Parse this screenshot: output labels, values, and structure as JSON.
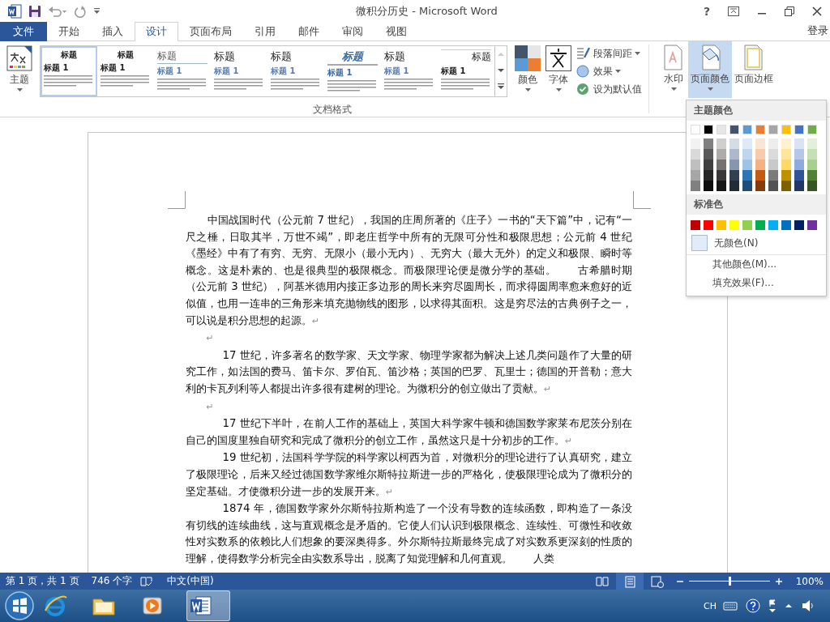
{
  "title_bar": {
    "title": "微积分历史 - Microsoft Word",
    "help": "?",
    "sign_in": "登录"
  },
  "tabs": [
    {
      "label": "文件",
      "kind": "file",
      "selected": false
    },
    {
      "label": "开始",
      "kind": "tab",
      "selected": false
    },
    {
      "label": "插入",
      "kind": "tab",
      "selected": false
    },
    {
      "label": "设计",
      "kind": "tab",
      "selected": true
    },
    {
      "label": "页面布局",
      "kind": "tab",
      "selected": false
    },
    {
      "label": "引用",
      "kind": "tab",
      "selected": false
    },
    {
      "label": "邮件",
      "kind": "tab",
      "selected": false
    },
    {
      "label": "审阅",
      "kind": "tab",
      "selected": false
    },
    {
      "label": "视图",
      "kind": "tab",
      "selected": false
    }
  ],
  "ribbon": {
    "theme_button": "主题",
    "style_gallery": [
      {
        "kind": "classic",
        "title": "标题",
        "heading": "标题 1",
        "selected": true
      },
      {
        "kind": "classic",
        "title": "标题",
        "heading": "标题 1",
        "selected": false
      },
      {
        "kind": "lined",
        "title": "标题",
        "heading": "标题 1",
        "selected": false
      },
      {
        "kind": "large",
        "title": "标题",
        "heading": "标题 1",
        "selected": false
      },
      {
        "kind": "large",
        "title": "标题",
        "heading": "标题 1",
        "selected": false
      },
      {
        "kind": "italic",
        "title": "标题",
        "heading": "标题 1",
        "selected": false
      },
      {
        "kind": "large",
        "title": "标题",
        "heading": "标题 1",
        "selected": false
      },
      {
        "kind": "right",
        "title": "标题",
        "heading": "标题 1",
        "selected": false
      }
    ],
    "group_label": "文档格式",
    "colors_button": "颜色",
    "fonts_button": "字体",
    "small_buttons": [
      {
        "kind": "spacing",
        "label": "段落间距",
        "dropdown": true
      },
      {
        "kind": "effects",
        "label": "效果",
        "dropdown": true
      },
      {
        "kind": "default",
        "label": "设为默认值",
        "dropdown": false
      }
    ],
    "page_background": [
      {
        "kind": "watermark",
        "label": "水印",
        "pressed": false
      },
      {
        "kind": "page-color",
        "label": "页面颜色",
        "pressed": true
      },
      {
        "kind": "border",
        "label": "页面边框",
        "pressed": false
      }
    ]
  },
  "page_color_menu": {
    "theme_heading": "主题颜色",
    "theme_colors": [
      {
        "color": "#ffffff",
        "shades": [
          {
            "color": "#f2f2f2"
          },
          {
            "color": "#d9d9d9"
          },
          {
            "color": "#bfbfbf"
          },
          {
            "color": "#a6a6a6"
          },
          {
            "color": "#808080"
          }
        ]
      },
      {
        "color": "#000000",
        "shades": [
          {
            "color": "#808080"
          },
          {
            "color": "#595959"
          },
          {
            "color": "#404040"
          },
          {
            "color": "#262626"
          },
          {
            "color": "#0d0d0d"
          }
        ]
      },
      {
        "color": "#e7e6e6",
        "shades": [
          {
            "color": "#d0cece"
          },
          {
            "color": "#aeabab"
          },
          {
            "color": "#757171"
          },
          {
            "color": "#3a3838"
          },
          {
            "color": "#171616"
          }
        ]
      },
      {
        "color": "#44546a",
        "shades": [
          {
            "color": "#d6dce4"
          },
          {
            "color": "#adb9ca"
          },
          {
            "color": "#8496b0"
          },
          {
            "color": "#333f4f"
          },
          {
            "color": "#222a35"
          }
        ]
      },
      {
        "color": "#5b9bd5",
        "shades": [
          {
            "color": "#deebf6"
          },
          {
            "color": "#bdd7ee"
          },
          {
            "color": "#9dc3e6"
          },
          {
            "color": "#2e75b5"
          },
          {
            "color": "#1f4e79"
          }
        ]
      },
      {
        "color": "#ed7d31",
        "shades": [
          {
            "color": "#fbe5d5"
          },
          {
            "color": "#f7cbac"
          },
          {
            "color": "#f4b183"
          },
          {
            "color": "#c55a11"
          },
          {
            "color": "#843c0b"
          }
        ]
      },
      {
        "color": "#a5a5a5",
        "shades": [
          {
            "color": "#ededed"
          },
          {
            "color": "#dbdbdb"
          },
          {
            "color": "#c9c9c9"
          },
          {
            "color": "#7b7b7b"
          },
          {
            "color": "#525252"
          }
        ]
      },
      {
        "color": "#ffc000",
        "shades": [
          {
            "color": "#fff2cc"
          },
          {
            "color": "#fee599"
          },
          {
            "color": "#ffd965"
          },
          {
            "color": "#bf9000"
          },
          {
            "color": "#7f6000"
          }
        ]
      },
      {
        "color": "#4472c4",
        "shades": [
          {
            "color": "#dae3f3"
          },
          {
            "color": "#b4c7e7"
          },
          {
            "color": "#8faadc"
          },
          {
            "color": "#2f5597"
          },
          {
            "color": "#203864"
          }
        ]
      },
      {
        "color": "#70ad47",
        "shades": [
          {
            "color": "#e2efd9"
          },
          {
            "color": "#c5e0b3"
          },
          {
            "color": "#a8d08d"
          },
          {
            "color": "#538135"
          },
          {
            "color": "#375623"
          }
        ]
      }
    ],
    "standard_heading": "标准色",
    "standard_colors": [
      {
        "color": "#c00000"
      },
      {
        "color": "#ff0000"
      },
      {
        "color": "#ffc000"
      },
      {
        "color": "#ffff00"
      },
      {
        "color": "#92d050"
      },
      {
        "color": "#00b050"
      },
      {
        "color": "#00b0f0"
      },
      {
        "color": "#0070c0"
      },
      {
        "color": "#002060"
      },
      {
        "color": "#7030a0"
      }
    ],
    "items": [
      {
        "kind": "swatch",
        "label": "无颜色(N)"
      },
      {
        "kind": "plain",
        "label": "其他颜色(M)..."
      },
      {
        "kind": "plain",
        "label": "填充效果(F)..."
      }
    ]
  },
  "document": {
    "paragraphs": [
      {
        "kind": "lead",
        "text": "中国战国时代（公元前 7 世纪），我国的庄周所著的《庄子》一书的“天下篇”中，记有“一尺之棰，日取其半，万世不竭”，即老庄哲学中所有的无限可分性和极限思想；公元前 4 世纪《墨经》中有了有穷、无穷、无限小（最小无内）、无穷大（最大无外）的定义和极限、瞬时等概念。这是朴素的、也是很典型的极限概念。而极限理论便是微分学的基础。　　古希腊时期（公元前 3 世纪），阿基米德用内接正多边形的周长来穷尽圆周长，而求得圆周率愈来愈好的近似值，也用一连串的三角形来填充抛物线的图形，以求得其面积。这是穷尽法的古典例子之一，可以说是积分思想的起源。",
        "mark": "↵"
      },
      {
        "kind": "empty",
        "mark": "↵"
      },
      {
        "kind": "indented",
        "text": "17 世纪，许多著名的数学家、天文学家、物理学家都为解决上述几类问题作了大量的研究工作，如法国的费马、笛卡尔、罗伯瓦、笛沙格；英国的巴罗、瓦里士；德国的开普勒；意大利的卡瓦列利等人都提出许多很有建树的理论。为微积分的创立做出了贡献。",
        "mark": "↵"
      },
      {
        "kind": "empty",
        "mark": "↵"
      },
      {
        "kind": "indented",
        "text": "17 世纪下半叶，在前人工作的基础上，英国大科学家牛顿和德国数学家莱布尼茨分别在自己的国度里独自研究和完成了微积分的创立工作，虽然这只是十分初步的工作。",
        "mark": "↵"
      },
      {
        "kind": "indented",
        "text": "19 世纪初，法国科学学院的科学家以柯西为首，对微积分的理论进行了认真研究，建立了极限理论，后来又经过德国数学家维尔斯特拉斯进一步的严格化，使极限理论成为了微积分的坚定基础。才使微积分进一步的发展开来。",
        "mark": "↵"
      },
      {
        "kind": "indented",
        "text": "1874 年，德国数学家外尔斯特拉斯构造了一个没有导数的连续函数，即构造了一条没有切线的连续曲线，这与直观概念是矛盾的。它使人们认识到极限概念、连续性、可微性和收敛性对实数系的依赖比人们想象的要深奥得多。外尔斯特拉斯最终完成了对实数系更深刻的性质的理解，使得数学分析完全由实数系导出，脱离了知觉理解和几何直观。　　人类"
      }
    ]
  },
  "status_bar": {
    "page": "第 1 页，共 1 页",
    "words": "746 个字",
    "language": "中文(中国)",
    "views": [
      {
        "kind": "read",
        "selected": false
      },
      {
        "kind": "print",
        "selected": true
      },
      {
        "kind": "web",
        "selected": false
      }
    ],
    "zoom": {
      "level": 0.5,
      "label": "100%"
    }
  },
  "taskbar": {
    "apps": [
      {
        "kind": "browser",
        "active": false
      },
      {
        "kind": "folder",
        "active": false
      },
      {
        "kind": "media",
        "active": false
      },
      {
        "kind": "word",
        "active": true
      }
    ],
    "input_language": "CH"
  }
}
